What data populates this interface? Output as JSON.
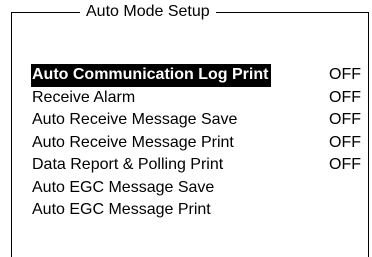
{
  "dialog": {
    "title": "Auto Mode Setup"
  },
  "menu": {
    "items": [
      {
        "label": "Auto Communication Log Print",
        "value": "OFF",
        "selected": true
      },
      {
        "label": "Receive Alarm",
        "value": "OFF"
      },
      {
        "label": "Auto Receive Message Save",
        "value": "OFF"
      },
      {
        "label": "Auto Receive Message Print",
        "value": "OFF"
      },
      {
        "label": "Data Report & Polling Print",
        "value": "OFF"
      },
      {
        "label": "Auto EGC Message Save",
        "value": ""
      },
      {
        "label": "Auto EGC Message Print",
        "value": ""
      }
    ]
  }
}
